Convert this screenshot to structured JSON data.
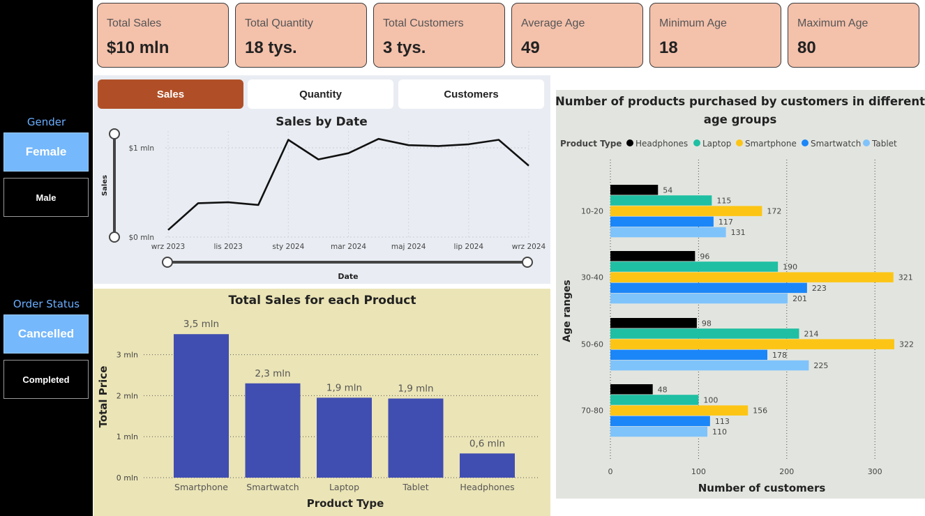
{
  "sidebar": {
    "gender": {
      "title": "Gender",
      "options": [
        {
          "label": "Female",
          "selected": true
        },
        {
          "label": "Male",
          "selected": false
        }
      ]
    },
    "order_status": {
      "title": "Order Status",
      "options": [
        {
          "label": "Cancelled",
          "selected": true
        },
        {
          "label": "Completed",
          "selected": false
        }
      ]
    }
  },
  "kpis": [
    {
      "label": "Total Sales",
      "value": "$10 mln"
    },
    {
      "label": "Total Quantity",
      "value": "18 tys."
    },
    {
      "label": "Total Customers",
      "value": "3 tys."
    },
    {
      "label": "Average Age",
      "value": "49"
    },
    {
      "label": "Minimum Age",
      "value": "18"
    },
    {
      "label": "Maximum Age",
      "value": "80"
    }
  ],
  "tabs": [
    {
      "label": "Sales",
      "active": true
    },
    {
      "label": "Quantity",
      "active": false
    },
    {
      "label": "Customers",
      "active": false
    }
  ],
  "colors": {
    "kpi_bg": "#f4c1ab",
    "tab_active": "#b04f27",
    "slicer_selected": "#75b8fb",
    "bar_product": "#404eb1",
    "headphones": "#000000",
    "laptop": "#1fbfa3",
    "smartphone": "#fcc515",
    "smartwatch": "#1b86f8",
    "tablet": "#7fc3fb"
  },
  "chart_data": [
    {
      "type": "line",
      "title": "Sales by Date",
      "xlabel": "Date",
      "ylabel": "Sales",
      "x_ticks": [
        "wrz 2023",
        "lis 2023",
        "sty 2024",
        "mar 2024",
        "maj 2024",
        "lip 2024",
        "wrz 2024"
      ],
      "y_ticks": [
        {
          "label": "$0 mln",
          "value": 0
        },
        {
          "label": "$1 mln",
          "value": 1
        }
      ],
      "x": [
        "2023-09",
        "2023-10",
        "2023-11",
        "2023-12",
        "2024-01",
        "2024-02",
        "2024-03",
        "2024-04",
        "2024-05",
        "2024-06",
        "2024-07",
        "2024-08",
        "2024-09"
      ],
      "values": [
        0.08,
        0.38,
        0.39,
        0.36,
        1.09,
        0.87,
        0.94,
        1.1,
        1.03,
        1.02,
        1.04,
        1.09,
        0.8
      ],
      "ylim": [
        0,
        1.5
      ],
      "grid": true,
      "color": "#111111"
    },
    {
      "type": "bar",
      "title": "Total Sales for each Product",
      "xlabel": "Product Type",
      "ylabel": "Total Price",
      "categories": [
        "Smartphone",
        "Smartwatch",
        "Laptop",
        "Tablet",
        "Headphones"
      ],
      "values": [
        3.5,
        2.3,
        1.95,
        1.93,
        0.59
      ],
      "data_labels": [
        "3,5 mln",
        "2,3 mln",
        "1,9 mln",
        "1,9 mln",
        "0,6 mln"
      ],
      "y_ticks": [
        {
          "label": "0 mln",
          "value": 0
        },
        {
          "label": "1 mln",
          "value": 1
        },
        {
          "label": "2 mln",
          "value": 2
        },
        {
          "label": "3 mln",
          "value": 3
        }
      ],
      "ylim": [
        0,
        3.5
      ],
      "grid": true,
      "color": "#404eb1"
    },
    {
      "type": "bar",
      "orientation": "horizontal",
      "title": "Number of products purchased by customers in different age groups",
      "xlabel": "Number of customers",
      "ylabel": "Age ranges",
      "legend_title": "Product Type",
      "legend_position": "top",
      "categories": [
        "10-20",
        "30-40",
        "50-60",
        "70-80"
      ],
      "series": [
        {
          "name": "Headphones",
          "color": "#000000",
          "values": [
            54,
            96,
            98,
            48
          ]
        },
        {
          "name": "Laptop",
          "color": "#1fbfa3",
          "values": [
            115,
            190,
            214,
            100
          ]
        },
        {
          "name": "Smartphone",
          "color": "#fcc515",
          "values": [
            172,
            321,
            322,
            156
          ]
        },
        {
          "name": "Smartwatch",
          "color": "#1b86f8",
          "values": [
            117,
            223,
            178,
            113
          ]
        },
        {
          "name": "Tablet",
          "color": "#7fc3fb",
          "values": [
            131,
            201,
            225,
            110
          ]
        }
      ],
      "x_ticks": [
        0,
        100,
        200,
        300
      ],
      "xlim": [
        0,
        330
      ],
      "grid": true
    }
  ]
}
